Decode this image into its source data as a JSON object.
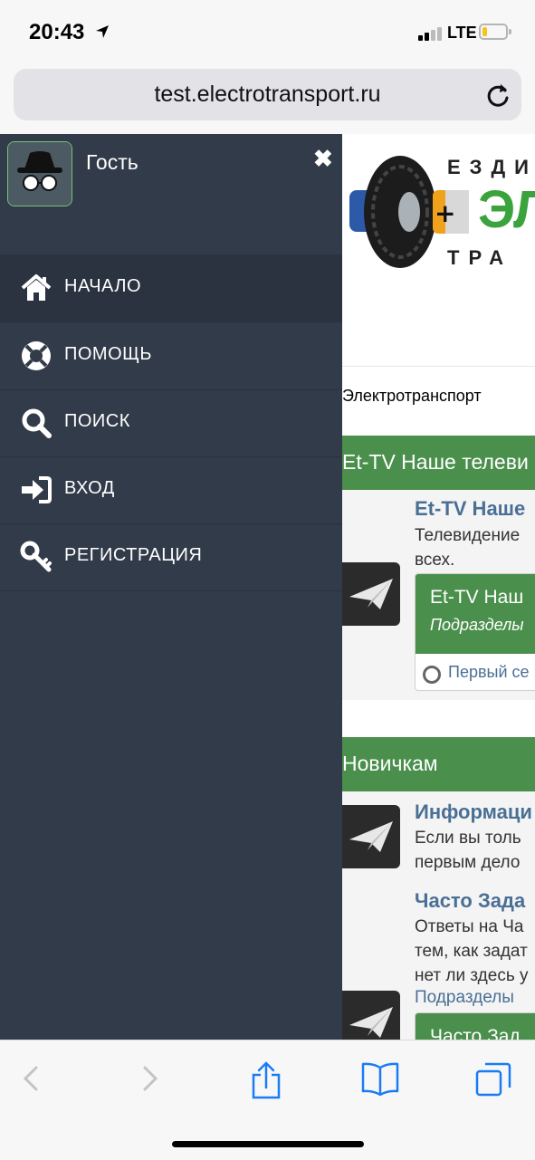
{
  "status": {
    "time": "20:43",
    "network": "LTE"
  },
  "browser": {
    "url": "test.electrotransport.ru"
  },
  "drawer": {
    "user_name": "Гость",
    "close_label": "✖",
    "items": [
      {
        "label": "НАЧАЛО",
        "icon": "home-icon"
      },
      {
        "label": "ПОМОЩЬ",
        "icon": "lifebuoy-icon"
      },
      {
        "label": "ПОИСК",
        "icon": "search-icon"
      },
      {
        "label": "ВХОД",
        "icon": "sign-in-icon"
      },
      {
        "label": "РЕГИСТРАЦИЯ",
        "icon": "key-icon"
      }
    ]
  },
  "site": {
    "logo_top": "ЕЗДИМ",
    "logo_big": "ЭЛ",
    "logo_bottom": "ТРА",
    "breadcrumb": "Электротранспорт",
    "categories": [
      {
        "title": "Et-TV Наше телеви",
        "forum_title": "Et-TV Наше",
        "forum_desc_1": "Телевидение",
        "forum_desc_2": "всех.",
        "sub_title": "Et-TV Наш",
        "sub_sub": "Подразделы",
        "sub_item": "Первый се"
      },
      {
        "title": "Новичкам",
        "forum1_title": "Информаци",
        "forum1_desc_1": "Если вы толь",
        "forum1_desc_2": "первым дело",
        "forum2_title": "Часто Зада",
        "forum2_desc_1": "Ответы на Ча",
        "forum2_desc_2": "тем, как задат",
        "forum2_desc_3": "нет ли здесь у",
        "forum2_link": "Подразделы",
        "sub_title": "Часто Зад"
      }
    ]
  },
  "toolbar": [
    "back-icon",
    "forward-icon",
    "share-icon",
    "bookmarks-icon",
    "tabs-icon"
  ]
}
